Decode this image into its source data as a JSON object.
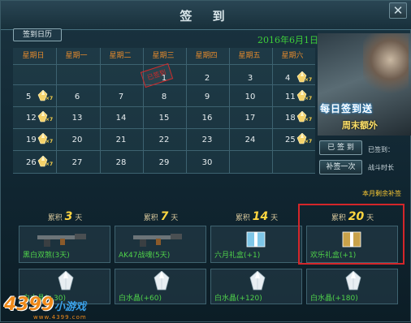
{
  "window": {
    "title": "签 到",
    "close": "✕"
  },
  "calendar": {
    "tab": "签到日历",
    "date": "2016年6月1日",
    "weekdays": [
      "星期日",
      "星期一",
      "星期二",
      "星期三",
      "星期四",
      "星期五",
      "星期六"
    ],
    "rows": [
      [
        "",
        "",
        "",
        "1",
        "2",
        "3",
        "4"
      ],
      [
        "5",
        "6",
        "7",
        "8",
        "9",
        "10",
        "11"
      ],
      [
        "12",
        "13",
        "14",
        "15",
        "16",
        "17",
        "18"
      ],
      [
        "19",
        "20",
        "21",
        "22",
        "23",
        "24",
        "25"
      ],
      [
        "26",
        "27",
        "28",
        "29",
        "30",
        "",
        ""
      ]
    ],
    "stamp": "已签到",
    "gem_badge": "×7"
  },
  "banner": {
    "line1": "每日签到送",
    "line2": "周末额外"
  },
  "buttons": {
    "signed": "已 签 到",
    "makeup": "补签一次"
  },
  "side": {
    "signed_days": "已签到：",
    "battle_time": "战斗时长",
    "remaining": "本月剩余补签"
  },
  "cumulative": [
    {
      "prefix": "累积",
      "num": "3",
      "suffix": "天",
      "reward": "黑白双煞(3天)",
      "crystal": "白水晶(+30)"
    },
    {
      "prefix": "累积",
      "num": "7",
      "suffix": "天",
      "reward": "AK47战魂(5天)",
      "crystal": "白水晶(+60)"
    },
    {
      "prefix": "累积",
      "num": "14",
      "suffix": "天",
      "reward": "六月礼盒(+1)",
      "crystal": "白水晶(+120)"
    },
    {
      "prefix": "累积",
      "num": "20",
      "suffix": "天",
      "reward": "欢乐礼盒(+1)",
      "crystal": "白水晶(+180)"
    }
  ],
  "watermark": {
    "logo": "4399",
    "name": "小游戏",
    "url": "www.4399.com"
  },
  "colors": {
    "accent_green": "#4fd24a",
    "weekday_orange": "#e58a2c",
    "highlight_red": "#d4262a"
  }
}
